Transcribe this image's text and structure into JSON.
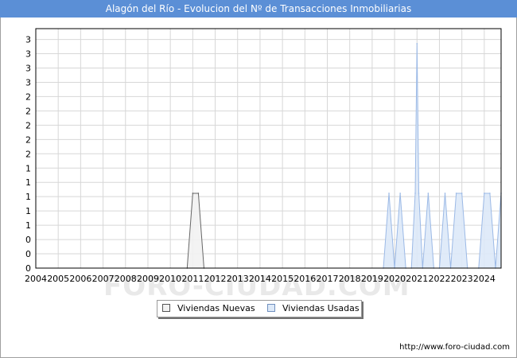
{
  "title": "Alagón del Río - Evolucion del Nº de Transacciones Inmobiliarias",
  "footer_url": "http://www.foro-ciudad.com",
  "watermark": "FORO-CIUDAD.COM",
  "colors": {
    "title_bar": "#5b8fd6",
    "nuevas_fill": "#f2f2f2",
    "nuevas_line": "#666666",
    "usadas_fill": "#dde9f8",
    "usadas_line": "#9bb9e6",
    "grid": "#d7d7d7"
  },
  "chart_data": {
    "type": "area",
    "title": "Alagón del Río - Evolucion del Nº de Transacciones Inmobiliarias",
    "xlabel": "",
    "ylabel": "",
    "x_tick_labels": [
      "2004",
      "2005",
      "2006",
      "2007",
      "2008",
      "2009",
      "2010",
      "2011",
      "2012",
      "2013",
      "2014",
      "2015",
      "2016",
      "2017",
      "2018",
      "2019",
      "2020",
      "2021",
      "2022",
      "2023",
      "2024"
    ],
    "y_tick_labels": [
      "0",
      "0",
      "0",
      "1",
      "1",
      "1",
      "1",
      "1",
      "2",
      "2",
      "2",
      "2",
      "2",
      "3",
      "3",
      "3",
      "3"
    ],
    "ylim": [
      0,
      3.2
    ],
    "xlim": [
      2004,
      2024.75
    ],
    "grid": true,
    "legend_position": "bottom-center",
    "series": [
      {
        "name": "Viviendas Nuevas",
        "fill": "#f2f2f2",
        "line": "#666666",
        "points": [
          [
            2010.75,
            0
          ],
          [
            2011.0,
            1
          ],
          [
            2011.25,
            1
          ],
          [
            2011.5,
            0
          ]
        ]
      },
      {
        "name": "Viviendas Usadas",
        "fill": "#dde9f8",
        "line": "#9bb9e6",
        "points": [
          [
            2019.5,
            0
          ],
          [
            2019.75,
            1
          ],
          [
            2020.0,
            0
          ],
          [
            2020.25,
            1
          ],
          [
            2020.5,
            0
          ],
          [
            2020.75,
            0
          ],
          [
            2020.92,
            1
          ],
          [
            2021.0,
            3
          ],
          [
            2021.08,
            1
          ],
          [
            2021.25,
            0
          ],
          [
            2021.5,
            1
          ],
          [
            2021.75,
            0
          ],
          [
            2022.0,
            0
          ],
          [
            2022.25,
            1
          ],
          [
            2022.5,
            0
          ],
          [
            2022.75,
            1
          ],
          [
            2023.0,
            1
          ],
          [
            2023.25,
            0
          ],
          [
            2023.75,
            0
          ],
          [
            2024.0,
            1
          ],
          [
            2024.25,
            1
          ],
          [
            2024.5,
            0
          ],
          [
            2024.75,
            1
          ]
        ]
      }
    ]
  }
}
